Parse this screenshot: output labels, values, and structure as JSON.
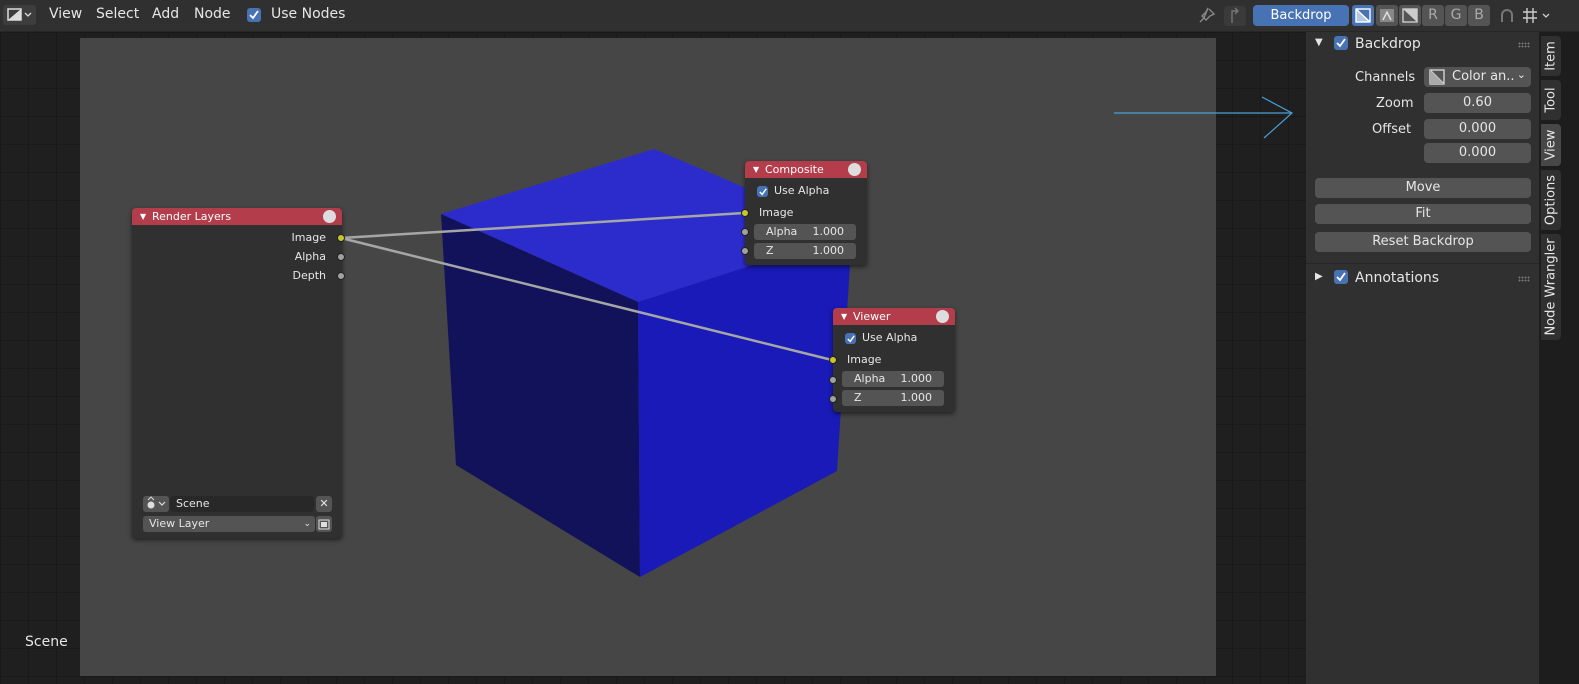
{
  "header": {
    "menu": [
      "View",
      "Select",
      "Add",
      "Node"
    ],
    "use_nodes_label": "Use Nodes",
    "backdrop_label": "Backdrop",
    "channel_letters": [
      "R",
      "G",
      "B"
    ]
  },
  "nodes": {
    "render_layers": {
      "title": "Render Layers",
      "outputs": [
        "Image",
        "Alpha",
        "Depth"
      ],
      "scene": "Scene",
      "view_layer": "View Layer"
    },
    "composite": {
      "title": "Composite",
      "use_alpha_label": "Use Alpha",
      "input_label": "Image",
      "alpha_label": "Alpha",
      "alpha_value": "1.000",
      "z_label": "Z",
      "z_value": "1.000"
    },
    "viewer": {
      "title": "Viewer",
      "use_alpha_label": "Use Alpha",
      "input_label": "Image",
      "alpha_label": "Alpha",
      "alpha_value": "1.000",
      "z_label": "Z",
      "z_value": "1.000"
    }
  },
  "status": {
    "scene_label": "Scene"
  },
  "sidebar": {
    "backdrop_panel": {
      "title": "Backdrop",
      "channels_label": "Channels",
      "channels_value": "Color an..",
      "zoom_label": "Zoom",
      "zoom_value": "0.60",
      "offset_label": "Offset",
      "offset_x": "0.000",
      "offset_y": "0.000",
      "move_label": "Move",
      "fit_label": "Fit",
      "reset_label": "Reset Backdrop"
    },
    "annotations_panel": {
      "title": "Annotations"
    }
  },
  "tabs": [
    "Item",
    "Tool",
    "View",
    "Options",
    "Node Wrangler"
  ],
  "colors": {
    "accent": "#4772b3",
    "node_header": "#b33d4b",
    "cube": "#1a1ab8"
  }
}
